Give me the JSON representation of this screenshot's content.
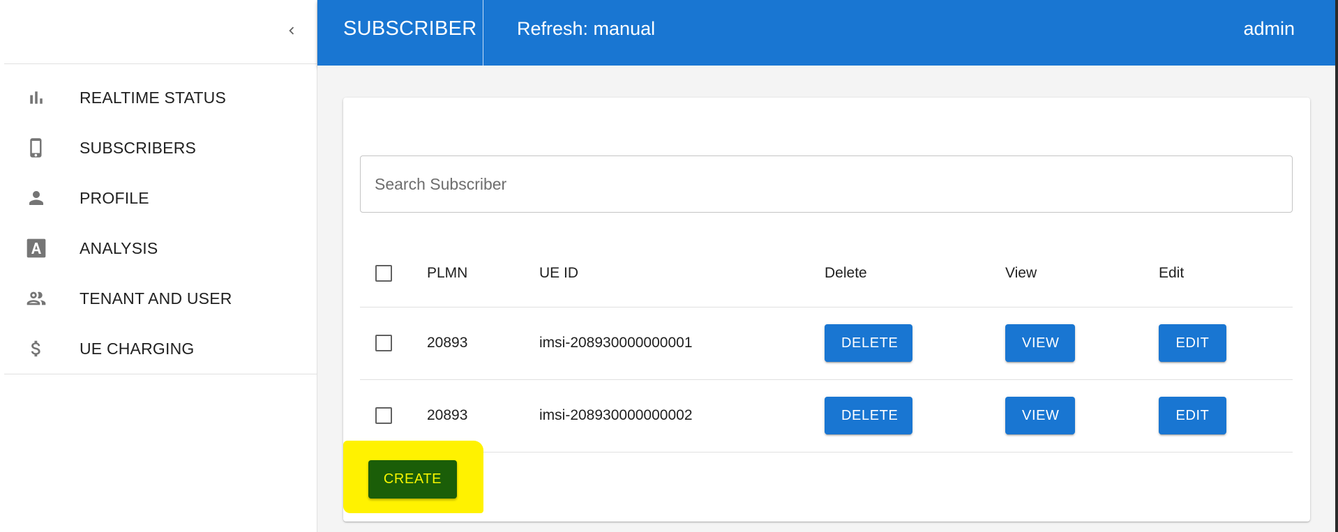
{
  "app_bar": {
    "title": "SUBSCRIBER",
    "refresh": "Refresh: manual",
    "user": "admin",
    "color": "#1976d2"
  },
  "sidebar": {
    "collapse_icon": "chevron-left-icon",
    "items": [
      {
        "label": "REALTIME STATUS",
        "icon": "bar-chart-icon"
      },
      {
        "label": "SUBSCRIBERS",
        "icon": "phone-icon"
      },
      {
        "label": "PROFILE",
        "icon": "person-icon"
      },
      {
        "label": "ANALYSIS",
        "icon": "letter-a-icon"
      },
      {
        "label": "TENANT AND USER",
        "icon": "people-icon"
      },
      {
        "label": "UE CHARGING",
        "icon": "dollar-icon"
      }
    ]
  },
  "search": {
    "placeholder": "Search Subscriber",
    "value": ""
  },
  "table": {
    "headers": {
      "plmn": "PLMN",
      "ue_id": "UE ID",
      "delete": "Delete",
      "view": "View",
      "edit": "Edit"
    },
    "rows": [
      {
        "plmn": "20893",
        "ue_id": "imsi-208930000000001",
        "delete": "DELETE",
        "view": "VIEW",
        "edit": "EDIT"
      },
      {
        "plmn": "20893",
        "ue_id": "imsi-208930000000002",
        "delete": "DELETE",
        "view": "VIEW",
        "edit": "EDIT"
      }
    ]
  },
  "create_button": {
    "label": "CREATE",
    "bg": "#1b5e08",
    "text_color": "#f4f400",
    "highlight": "#fff200"
  }
}
